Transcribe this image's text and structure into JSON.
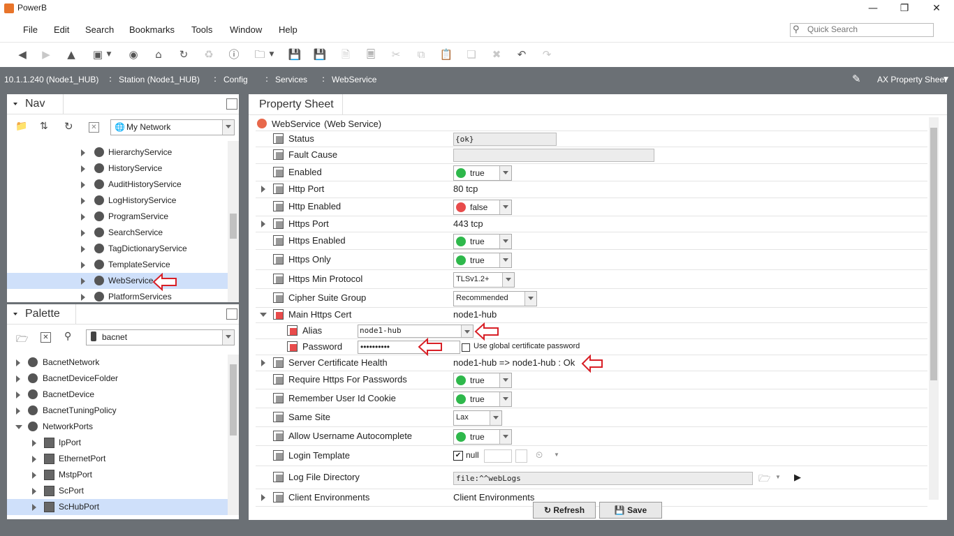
{
  "window": {
    "title": "PowerB"
  },
  "menu": [
    "File",
    "Edit",
    "Search",
    "Bookmarks",
    "Tools",
    "Window",
    "Help"
  ],
  "quick_search": {
    "placeholder": "Quick Search"
  },
  "breadcrumbs": [
    "10.1.1.240 (Node1_HUB)",
    "Station (Node1_HUB)",
    "Config",
    "Services",
    "WebService"
  ],
  "view_selector": "AX Property Sheet",
  "nav": {
    "title": "Nav",
    "network_select": "My Network",
    "items": [
      {
        "label": "HierarchyService",
        "icon": "hierarchy-icon"
      },
      {
        "label": "HistoryService",
        "icon": "history-icon"
      },
      {
        "label": "AuditHistoryService",
        "icon": "audit-history-icon"
      },
      {
        "label": "LogHistoryService",
        "icon": "log-history-icon"
      },
      {
        "label": "ProgramService",
        "icon": "program-icon"
      },
      {
        "label": "SearchService",
        "icon": "search-service-icon"
      },
      {
        "label": "TagDictionaryService",
        "icon": "tag-dictionary-icon"
      },
      {
        "label": "TemplateService",
        "icon": "template-icon"
      },
      {
        "label": "WebService",
        "icon": "globe-icon",
        "selected": true
      },
      {
        "label": "PlatformServices",
        "icon": "platform-icon"
      }
    ]
  },
  "palette": {
    "title": "Palette",
    "module_select": "bacnet",
    "items": [
      {
        "label": "BacnetNetwork",
        "level": 0,
        "expand": "collapsed"
      },
      {
        "label": "BacnetDeviceFolder",
        "level": 0,
        "expand": "collapsed"
      },
      {
        "label": "BacnetDevice",
        "level": 0,
        "expand": "collapsed"
      },
      {
        "label": "BacnetTuningPolicy",
        "level": 0,
        "expand": "collapsed"
      },
      {
        "label": "NetworkPorts",
        "level": 0,
        "expand": "expanded"
      },
      {
        "label": "IpPort",
        "level": 1,
        "expand": "collapsed"
      },
      {
        "label": "EthernetPort",
        "level": 1,
        "expand": "collapsed"
      },
      {
        "label": "MstpPort",
        "level": 1,
        "expand": "collapsed"
      },
      {
        "label": "ScPort",
        "level": 1,
        "expand": "collapsed"
      },
      {
        "label": "ScHubPort",
        "level": 1,
        "expand": "collapsed",
        "selected": true
      }
    ]
  },
  "property_sheet": {
    "tab": "Property Sheet",
    "root_name": "WebService",
    "root_type": "(Web Service)",
    "rows": [
      {
        "name": "Status",
        "type": "textfield",
        "value": "{ok}"
      },
      {
        "name": "Fault Cause",
        "type": "textfield",
        "value": ""
      },
      {
        "name": "Enabled",
        "type": "bool",
        "value": "true",
        "color": "#2eb84b"
      },
      {
        "name": "Http Port",
        "type": "text",
        "value": "80 tcp",
        "expandable": true
      },
      {
        "name": "Http Enabled",
        "type": "bool",
        "value": "false",
        "color": "#e84b4b"
      },
      {
        "name": "Https Port",
        "type": "text",
        "value": "443 tcp",
        "expandable": true
      },
      {
        "name": "Https Enabled",
        "type": "bool",
        "value": "true",
        "color": "#2eb84b"
      },
      {
        "name": "Https Only",
        "type": "bool",
        "value": "true",
        "color": "#2eb84b"
      },
      {
        "name": "Https Min Protocol",
        "type": "select",
        "value": "TLSv1.2+"
      },
      {
        "name": "Cipher Suite Group",
        "type": "select",
        "value": "Recommended"
      },
      {
        "name": "Main Https Cert",
        "type": "text",
        "value": "node1-hub",
        "expanded": true
      },
      {
        "name": "Alias",
        "type": "alias",
        "value": "node1-hub",
        "child": true
      },
      {
        "name": "Password",
        "type": "password",
        "value": "••••••••••",
        "child": true,
        "checkbox_label": "Use global certificate password"
      },
      {
        "name": "Server Certificate Health",
        "type": "text",
        "value": "node1-hub => node1-hub : Ok",
        "expandable": true
      },
      {
        "name": "Require Https For Passwords",
        "type": "bool",
        "value": "true",
        "color": "#2eb84b"
      },
      {
        "name": "Remember User Id Cookie",
        "type": "bool",
        "value": "true",
        "color": "#2eb84b"
      },
      {
        "name": "Same Site",
        "type": "select",
        "value": "Lax"
      },
      {
        "name": "Allow Username Autocomplete",
        "type": "bool",
        "value": "true",
        "color": "#2eb84b"
      },
      {
        "name": "Login Template",
        "type": "null",
        "value": "null"
      },
      {
        "name": "Log File Directory",
        "type": "file",
        "value": "file:^^webLogs"
      },
      {
        "name": "Client Environments",
        "type": "text",
        "value": "Client Environments",
        "expandable": true
      }
    ]
  },
  "buttons": {
    "refresh": "Refresh",
    "save": "Save"
  }
}
